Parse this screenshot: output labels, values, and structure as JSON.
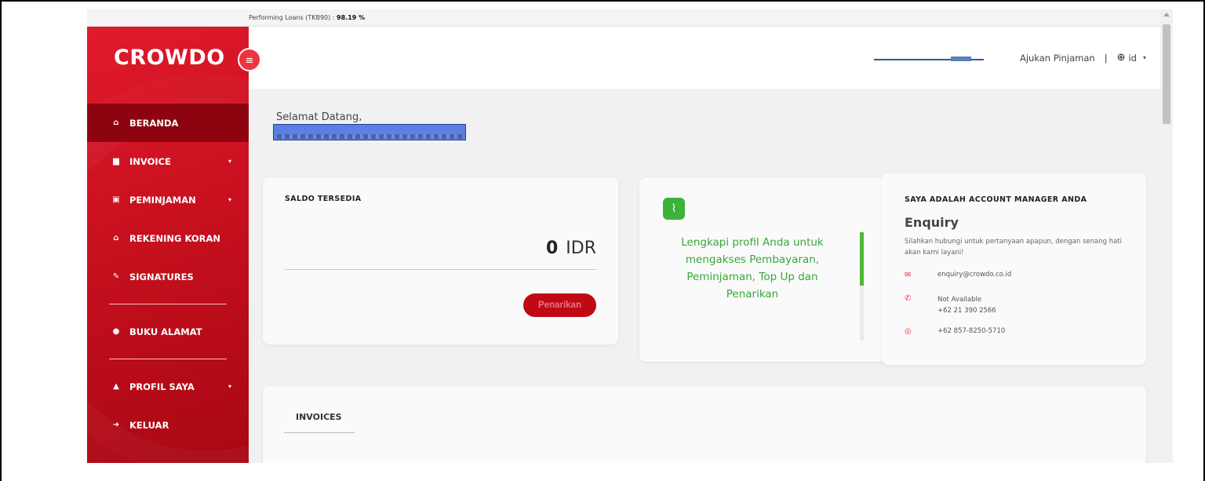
{
  "topstrip": {
    "label": "Performing Loans (TKB90) :",
    "value": "98.19 %"
  },
  "brand": {
    "logo": "CROWDO",
    "menu_icon": "hamburger-icon",
    "primary_color": "#d4121f"
  },
  "sidebar": {
    "items": [
      {
        "label": "BERANDA",
        "icon": "home-icon",
        "glyph": "⌂",
        "active": true
      },
      {
        "label": "INVOICE",
        "icon": "file-icon",
        "glyph": "▆",
        "caret": true
      },
      {
        "label": "PEMINJAMAN",
        "icon": "money-icon",
        "glyph": "▣",
        "caret": true
      },
      {
        "label": "REKENING KORAN",
        "icon": "bank-icon",
        "glyph": "⌂"
      },
      {
        "label": "SIGNATURES",
        "icon": "signature-icon",
        "glyph": "✎"
      },
      {
        "label": "BUKU ALAMAT",
        "icon": "users-icon",
        "glyph": "●"
      },
      {
        "label": "PROFIL SAYA",
        "icon": "user-icon",
        "glyph": "▲",
        "caret": true
      },
      {
        "label": "KELUAR",
        "icon": "logout-icon",
        "glyph": "➜"
      }
    ]
  },
  "header": {
    "link": "Ajukan Pinjaman",
    "separator": "|",
    "language": "id",
    "globe_icon": "globe-icon"
  },
  "welcome": {
    "greeting": "Selamat Datang,"
  },
  "saldo": {
    "title": "SALDO TERSEDIA",
    "amount": "0",
    "currency": "IDR",
    "button": "Penarikan"
  },
  "profile_card": {
    "icon": "paperclip-icon",
    "message": "Lengkapi profil Anda untuk mengakses Pembayaran, Peminjaman, Top Up dan Penarikan"
  },
  "account_manager": {
    "title": "SAYA ADALAH ACCOUNT MANAGER ANDA",
    "name": "Enquiry",
    "description": "Silahkan hubungi untuk pertanyaan apapun, dengan senang hati akan kami layani!",
    "email": "enquiry@crowdo.co.id",
    "phone_status": "Not Available",
    "phone": "+62 21 390 2566",
    "whatsapp": "+62 857-8250-5710"
  },
  "invoices": {
    "title": "INVOICES"
  }
}
